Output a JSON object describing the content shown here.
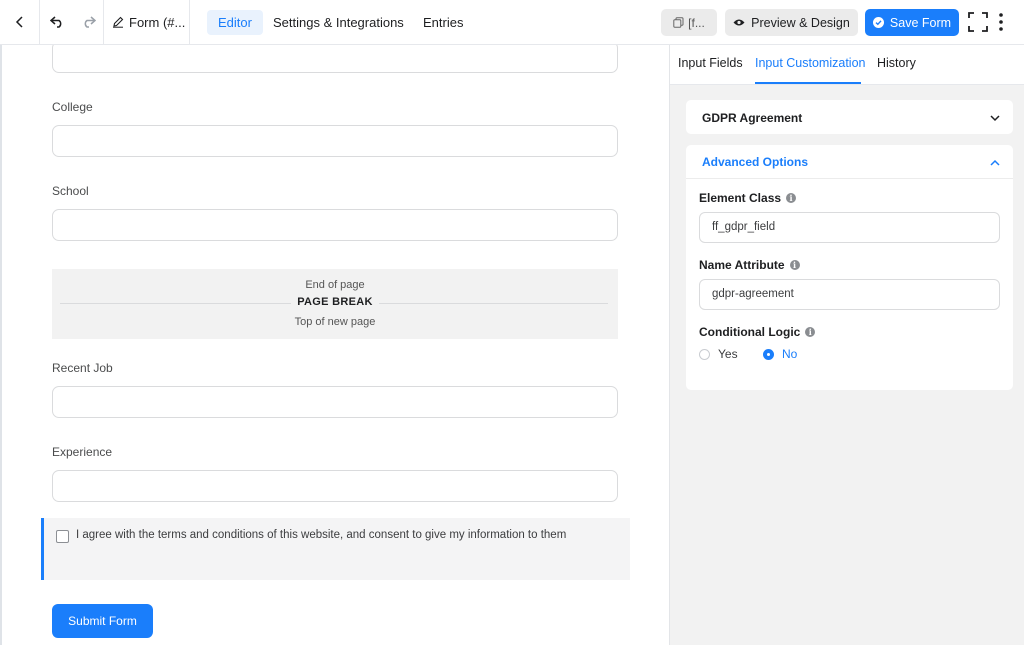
{
  "toolbar": {
    "form_title": "Form (#...",
    "tabs": [
      {
        "label": "Editor",
        "active": true
      },
      {
        "label": "Settings & Integrations",
        "active": false
      },
      {
        "label": "Entries",
        "active": false
      }
    ],
    "shortcode_label": "[f...",
    "preview_label": "Preview & Design",
    "save_label": "Save Form"
  },
  "form": {
    "fields": [
      {
        "label": "College"
      },
      {
        "label": "School"
      },
      {
        "label": "Recent Job"
      },
      {
        "label": "Experience"
      }
    ],
    "page_break": {
      "end_text": "End of page",
      "title": "PAGE BREAK",
      "top_text": "Top of new page"
    },
    "gdpr_text": "I agree with the terms and conditions of this website, and consent to give my information to them",
    "submit_label": "Submit Form"
  },
  "sidebar": {
    "tabs": [
      {
        "label": "Input Fields",
        "active": false
      },
      {
        "label": "Input Customization",
        "active": true
      },
      {
        "label": "History",
        "active": false
      }
    ],
    "gdpr_panel_title": "GDPR Agreement",
    "advanced": {
      "title": "Advanced Options",
      "element_class_label": "Element Class",
      "element_class_value": "ff_gdpr_field",
      "name_attribute_label": "Name Attribute",
      "name_attribute_value": "gdpr-agreement",
      "conditional_logic_label": "Conditional Logic",
      "options": [
        {
          "label": "Yes",
          "selected": false
        },
        {
          "label": "No",
          "selected": true
        }
      ]
    }
  },
  "colors": {
    "accent": "#1a7efb",
    "panel_bg": "#f2f2f2",
    "border": "#dadbdd"
  },
  "icons": [
    "back-icon",
    "undo-icon",
    "redo-icon",
    "edit-icon",
    "copy-icon",
    "eye-icon",
    "check-circle-icon",
    "fullscreen-icon",
    "more-vertical-icon",
    "chevron-down-icon",
    "chevron-up-icon",
    "info-icon"
  ]
}
